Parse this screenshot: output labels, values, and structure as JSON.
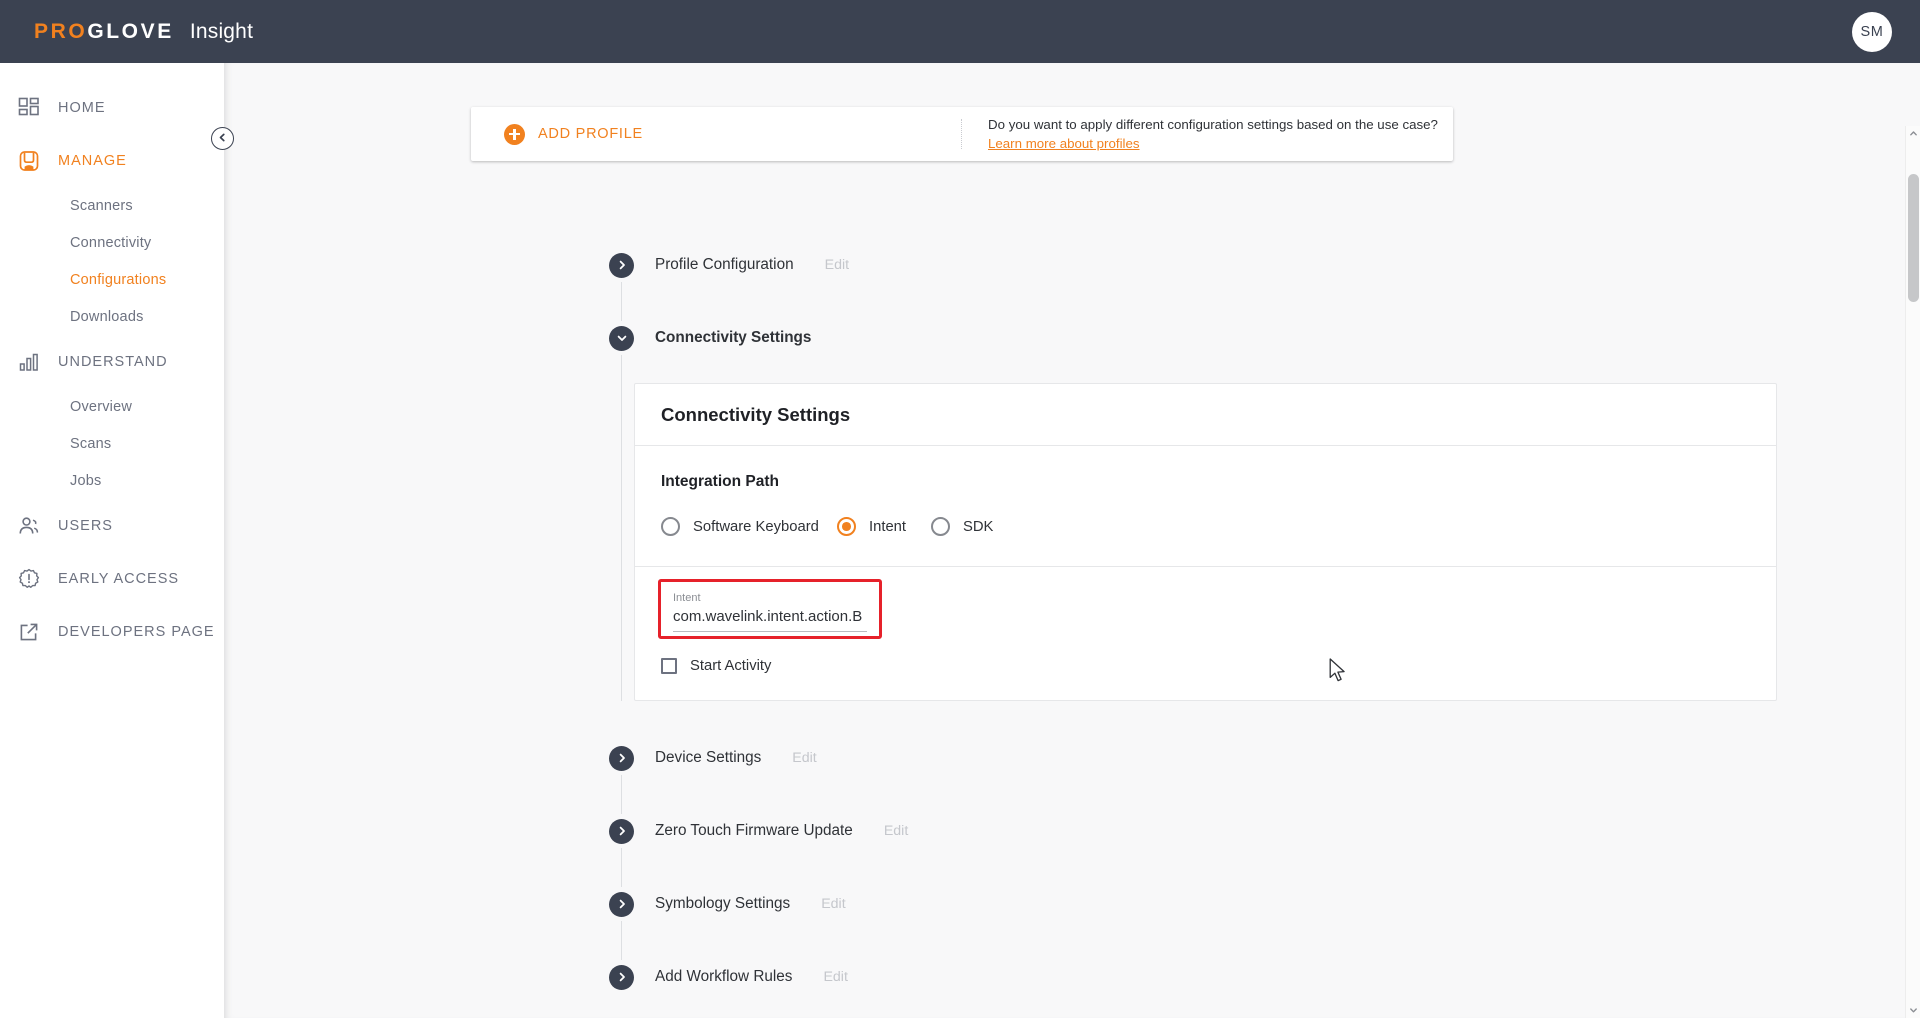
{
  "header": {
    "brand_pro": "PRO",
    "brand_glove": "GLOVE",
    "product": "Insight",
    "avatar_initials": "SM"
  },
  "sidebar": {
    "collapse_icon": "chevron-left-icon",
    "items": [
      {
        "label": "HOME",
        "icon": "dashboard-grid-icon",
        "active": false,
        "children": []
      },
      {
        "label": "MANAGE",
        "icon": "glove-icon",
        "active": true,
        "children": [
          {
            "label": "Scanners",
            "active": false
          },
          {
            "label": "Connectivity",
            "active": false
          },
          {
            "label": "Configurations",
            "active": true
          },
          {
            "label": "Downloads",
            "active": false
          }
        ]
      },
      {
        "label": "UNDERSTAND",
        "icon": "bar-chart-icon",
        "active": false,
        "children": [
          {
            "label": "Overview",
            "active": false
          },
          {
            "label": "Scans",
            "active": false
          },
          {
            "label": "Jobs",
            "active": false
          }
        ]
      },
      {
        "label": "USERS",
        "icon": "users-icon",
        "active": false,
        "children": []
      },
      {
        "label": "EARLY ACCESS",
        "icon": "badge-exclamation-icon",
        "active": false,
        "children": []
      },
      {
        "label": "DEVELOPERS PAGE",
        "icon": "external-link-icon",
        "active": false,
        "children": []
      }
    ]
  },
  "profile_bar": {
    "add_profile_label": "ADD PROFILE",
    "add_icon": "plus-circle-icon",
    "question": "Do you want to apply different configuration settings based on the use case?",
    "link": "Learn more about profiles"
  },
  "accordion": {
    "edit_label": "Edit",
    "sections": [
      {
        "title": "Profile Configuration",
        "expanded": false,
        "has_edit": true
      },
      {
        "title": "Connectivity Settings",
        "expanded": true,
        "has_edit": false
      },
      {
        "title": "Device Settings",
        "expanded": false,
        "has_edit": true
      },
      {
        "title": "Zero Touch Firmware Update",
        "expanded": false,
        "has_edit": true
      },
      {
        "title": "Symbology Settings",
        "expanded": false,
        "has_edit": true
      },
      {
        "title": "Add Workflow Rules",
        "expanded": false,
        "has_edit": true
      }
    ]
  },
  "connectivity_card": {
    "title": "Connectivity Settings",
    "integration_path": {
      "label": "Integration Path",
      "selected": "Intent",
      "options": [
        {
          "label": "Software Keyboard",
          "checked": false
        },
        {
          "label": "Intent",
          "checked": true
        },
        {
          "label": "SDK",
          "checked": false
        }
      ]
    },
    "intent_field": {
      "label": "Intent",
      "value": "com.wavelink.intent.action.B",
      "error_highlight_color": "#e6212a"
    },
    "start_activity": {
      "label": "Start Activity",
      "checked": false
    }
  },
  "colors": {
    "brand_orange": "#f1811f",
    "topbar": "#3b4251",
    "page_bg": "#f8f8f9",
    "error_red": "#e6212a"
  }
}
